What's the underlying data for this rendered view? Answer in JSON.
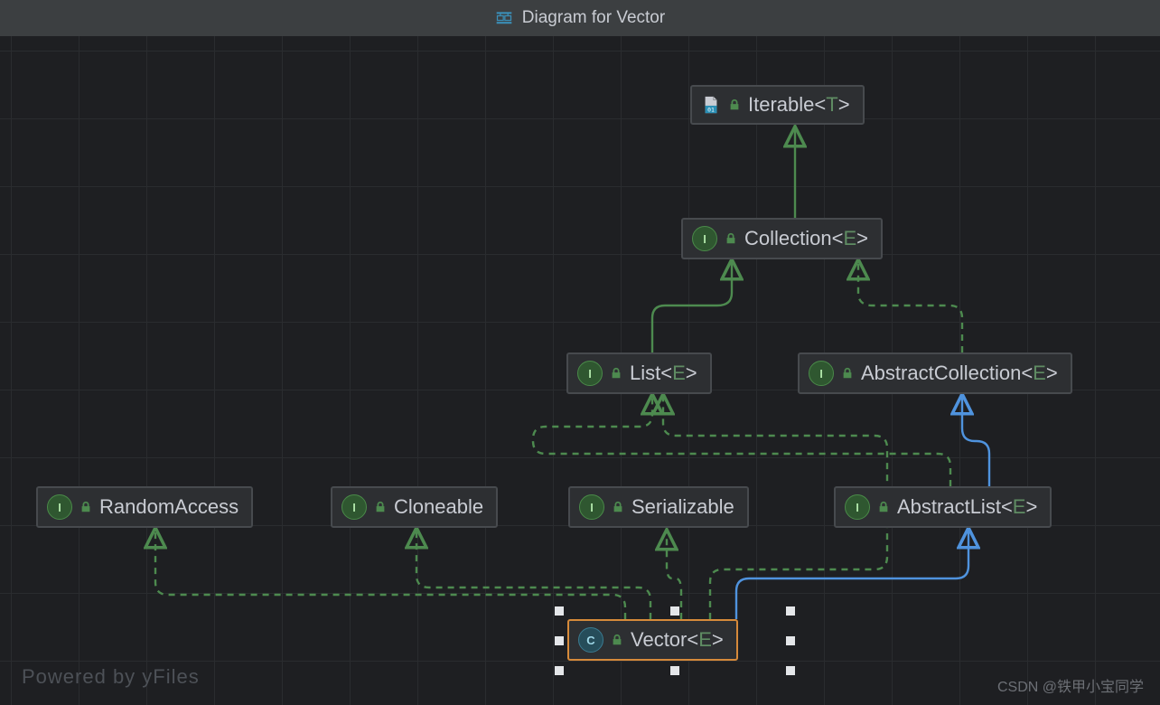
{
  "title": "Diagram for Vector",
  "footer_left": "Powered by yFiles",
  "footer_right": "CSDN @铁甲小宝同学",
  "badges": {
    "interface": "I",
    "class": "C"
  },
  "nodes": {
    "iterable": {
      "name": "Iterable",
      "param": "T",
      "kind": "classfile"
    },
    "collection": {
      "name": "Collection",
      "param": "E",
      "kind": "interface"
    },
    "list": {
      "name": "List",
      "param": "E",
      "kind": "interface"
    },
    "abscoll": {
      "name": "AbstractCollection",
      "param": "E",
      "kind": "interface"
    },
    "random": {
      "name": "RandomAccess",
      "param": "",
      "kind": "interface"
    },
    "cloneable": {
      "name": "Cloneable",
      "param": "",
      "kind": "interface"
    },
    "serializable": {
      "name": "Serializable",
      "param": "",
      "kind": "interface"
    },
    "abslist": {
      "name": "AbstractList",
      "param": "E",
      "kind": "interface"
    },
    "vector": {
      "name": "Vector",
      "param": "E",
      "kind": "class",
      "selected": true
    }
  },
  "edges": [
    {
      "from": "collection",
      "to": "iterable",
      "type": "extends-solid"
    },
    {
      "from": "list",
      "to": "collection",
      "type": "extends-solid"
    },
    {
      "from": "abscoll",
      "to": "collection",
      "type": "implements-dashed"
    },
    {
      "from": "abslist",
      "to": "list",
      "type": "implements-dashed"
    },
    {
      "from": "abslist",
      "to": "abscoll",
      "type": "extends-class-blue"
    },
    {
      "from": "vector",
      "to": "abslist",
      "type": "extends-class-blue"
    },
    {
      "from": "vector",
      "to": "random",
      "type": "implements-dashed"
    },
    {
      "from": "vector",
      "to": "cloneable",
      "type": "implements-dashed"
    },
    {
      "from": "vector",
      "to": "serializable",
      "type": "implements-dashed"
    },
    {
      "from": "vector",
      "to": "list",
      "type": "implements-dashed"
    }
  ],
  "legend": {
    "extends-solid": "solid green arrow (interface extends interface)",
    "implements-dashed": "dashed green arrow (implements / abstract link)",
    "extends-class-blue": "solid blue arrow (class extends class)"
  }
}
